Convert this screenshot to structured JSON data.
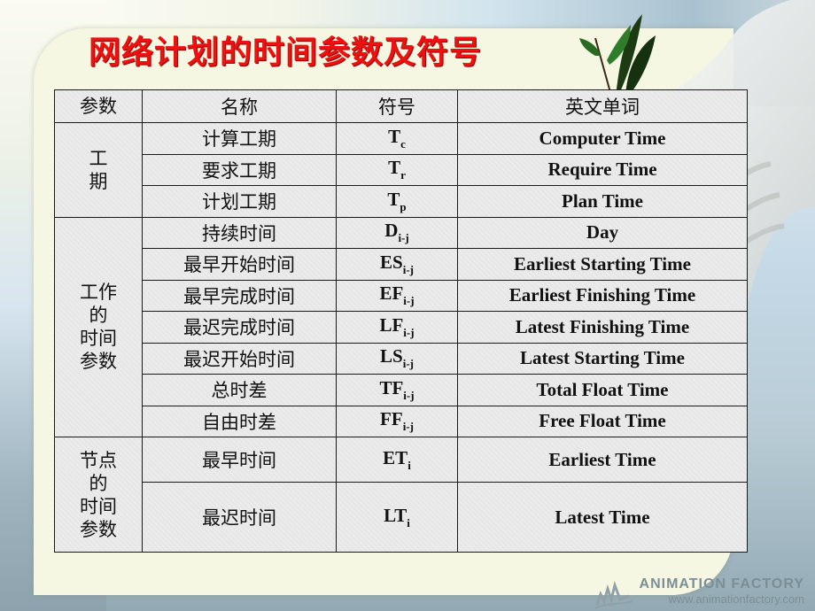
{
  "slide": {
    "title": "网络计划的时间参数及符号"
  },
  "table": {
    "headers": [
      "参数",
      "名称",
      "符号",
      "英文单词"
    ],
    "groups": [
      {
        "label": "工\n期",
        "rows": [
          {
            "name": "计算工期",
            "symbol": "T",
            "sub": "c",
            "english": "Computer Time"
          },
          {
            "name": "要求工期",
            "symbol": "T",
            "sub": "r",
            "english": "Require Time"
          },
          {
            "name": "计划工期",
            "symbol": "T",
            "sub": "p",
            "english": "Plan Time"
          }
        ]
      },
      {
        "label": "工作\n的\n时间\n参数",
        "rows": [
          {
            "name": "持续时间",
            "symbol": "D",
            "sub": "i-j",
            "english": "Day"
          },
          {
            "name": "最早开始时间",
            "symbol": "ES",
            "sub": "i-j",
            "english": "Earliest Starting Time"
          },
          {
            "name": "最早完成时间",
            "symbol": "EF",
            "sub": "i-j",
            "english": "Earliest Finishing Time"
          },
          {
            "name": "最迟完成时间",
            "symbol": "LF",
            "sub": "i-j",
            "english": "Latest Finishing Time"
          },
          {
            "name": "最迟开始时间",
            "symbol": "LS",
            "sub": "i-j",
            "english": "Latest Starting Time"
          },
          {
            "name": "总时差",
            "symbol": "TF",
            "sub": "i-j",
            "english": "Total Float Time"
          },
          {
            "name": "自由时差",
            "symbol": "FF",
            "sub": "i-j",
            "english": "Free Float Time"
          }
        ]
      },
      {
        "label": "节点\n的\n时间\n参数",
        "rows": [
          {
            "name": "最早时间",
            "symbol": "ET",
            "sub": "i",
            "english": "Earliest Time"
          },
          {
            "name": "最迟时间",
            "symbol": "LT",
            "sub": "i",
            "english": "Latest Time"
          }
        ]
      }
    ]
  },
  "watermark": {
    "brand": "ANIMATION FACTORY",
    "url": "www.animationfactory.com"
  },
  "decor": {
    "icons": [
      "olive-branch-icon",
      "dove-icon"
    ],
    "title_color": "#ee1111"
  }
}
